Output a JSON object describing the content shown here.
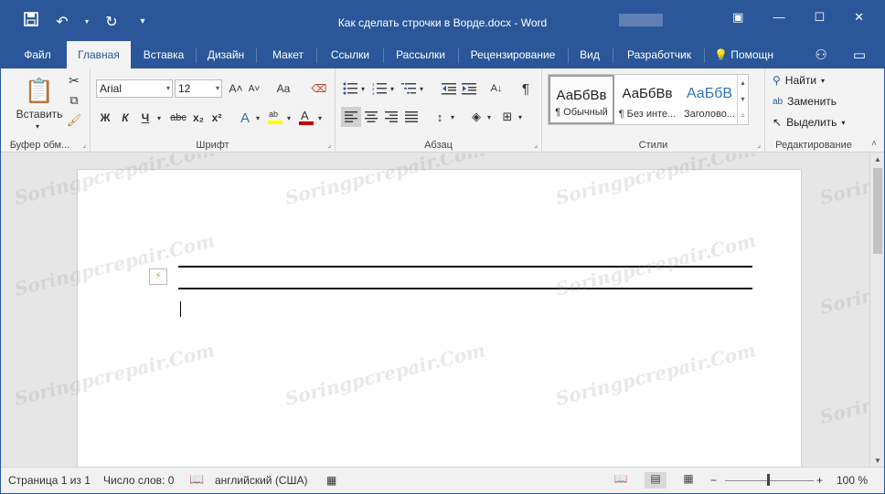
{
  "title_bar": {
    "doc_title": "Как сделать строчки в Ворде.docx - Word",
    "qat_icons": [
      "save-icon",
      "undo-icon",
      "redo-icon",
      "customize-icon"
    ],
    "right_icons": [
      "ribbon-display-icon",
      "minimize-icon",
      "restore-icon",
      "close-icon"
    ]
  },
  "tabs": {
    "items": [
      {
        "label": "Файл"
      },
      {
        "label": "Главная"
      },
      {
        "label": "Вставка"
      },
      {
        "label": "Дизайн"
      },
      {
        "label": "Макет"
      },
      {
        "label": "Ссылки"
      },
      {
        "label": "Рассылки"
      },
      {
        "label": "Рецензирование"
      },
      {
        "label": "Вид"
      },
      {
        "label": "Разработчик"
      }
    ],
    "active": "Главная",
    "tell_me": "Помощн"
  },
  "ribbon": {
    "clipboard": {
      "label": "Буфер обм...",
      "paste_label": "Вставить"
    },
    "font": {
      "label": "Шрифт",
      "font_name": "Arial",
      "font_size": "12",
      "bold": "Ж",
      "italic": "К",
      "underline": "Ч",
      "strike": "abc",
      "subscript": "x₂",
      "superscript": "x²",
      "grow": "A˄",
      "shrink": "A˅",
      "case": "Aa",
      "font_color_hex": "#c00000",
      "highlight_hex": "#ffff00"
    },
    "paragraph": {
      "label": "Абзац",
      "pilcrow": "¶"
    },
    "styles": {
      "label": "Стили",
      "items": [
        {
          "sample": "АаБбВв",
          "name": "¶ Обычный"
        },
        {
          "sample": "АаБбВв",
          "name": "¶ Без инте..."
        },
        {
          "sample": "АаБбВ",
          "name": "Заголово..."
        }
      ],
      "heading_color_hex": "#2e74b5"
    },
    "editing": {
      "label": "Редактирование",
      "find": "Найти",
      "replace": "Заменить",
      "select": "Выделить"
    }
  },
  "document": {
    "watermark": "Soringpcrepair.Com"
  },
  "status_bar": {
    "page": "Страница 1 из 1",
    "words": "Число слов: 0",
    "language": "английский (США)",
    "zoom": "100 %",
    "zoom_minus": "−",
    "zoom_plus": "+"
  },
  "colors": {
    "accent": "#2b579a",
    "ribbon_bg": "#f3f3f3",
    "page_bg": "#ffffff"
  }
}
